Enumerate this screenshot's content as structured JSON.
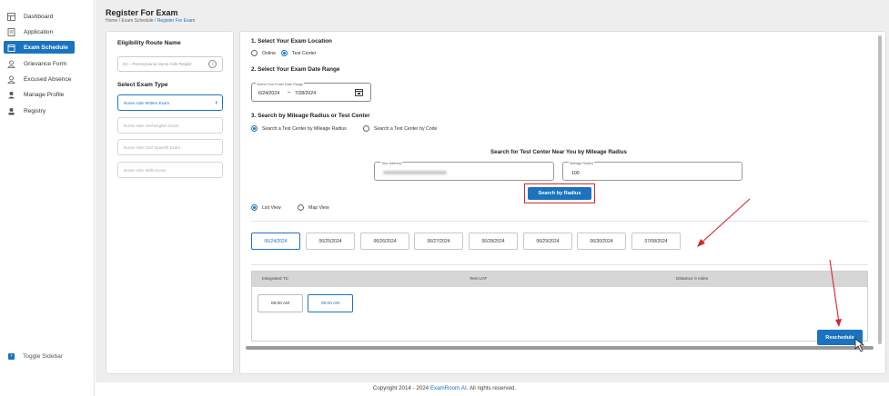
{
  "sidebar": {
    "items": [
      {
        "label": "Dashboard",
        "icon": "grid-icon",
        "active": false
      },
      {
        "label": "Application",
        "icon": "document-icon",
        "active": false
      },
      {
        "label": "Exam Schedule",
        "icon": "calendar-icon",
        "active": true
      },
      {
        "label": "Grievance Form",
        "icon": "person-alert-icon",
        "active": false
      },
      {
        "label": "Excused Absence",
        "icon": "person-alert-icon",
        "active": false
      },
      {
        "label": "Manage Profile",
        "icon": "user-icon",
        "active": false
      },
      {
        "label": "Registry",
        "icon": "user-badge-icon",
        "active": false
      }
    ],
    "toggle_label": "Toggle Sidebar"
  },
  "header": {
    "title": "Register For Exam",
    "breadcrumb": {
      "home": "Home",
      "sep": " / ",
      "middle": "Exam Schedule",
      "current": "Register For Exam"
    }
  },
  "left": {
    "eligibility_title": "Eligibility Route Name",
    "eligibility_value": "E3 – Pennsylvania Nurse Aide Registr",
    "exam_type_title": "Select Exam Type",
    "exam_types": [
      {
        "label": "Nurse Aide Written Exam",
        "selected": true
      },
      {
        "label": "Nurse Aide Oral English Exam",
        "selected": false
      },
      {
        "label": "Nurse Aide Oral Spanish Exam",
        "selected": false
      },
      {
        "label": "Nurse Aide Skills Exam",
        "selected": false
      }
    ]
  },
  "step1": {
    "title": "1. Select Your Exam Location",
    "options": [
      {
        "label": "Online",
        "selected": false
      },
      {
        "label": "Test Center",
        "selected": true
      }
    ]
  },
  "step2": {
    "title": "2. Select Your Exam Date Range",
    "range_label": "Select Your Exam Date Range",
    "start": "6/24/2024",
    "dash": "–",
    "end": "7/28/2024"
  },
  "step3": {
    "title": "3. Search by Mileage Radius or Test Center",
    "options": [
      {
        "label": "Search a Test Center by Mileage Radius",
        "selected": true
      },
      {
        "label": "Search a Test Center by Code",
        "selected": false
      }
    ],
    "search_heading": "Search for Test Center Near You by Mileage Radius",
    "address_label": "Your Address",
    "radius_label": "Mileage Radius",
    "radius_value": "100",
    "search_button": "Search by Radius"
  },
  "view": {
    "options": [
      {
        "label": "List View",
        "selected": true
      },
      {
        "label": "Map View",
        "selected": false
      }
    ]
  },
  "dates": [
    {
      "label": "06/24/2024",
      "selected": true
    },
    {
      "label": "06/25/2024",
      "selected": false
    },
    {
      "label": "06/26/2024",
      "selected": false
    },
    {
      "label": "06/27/2024",
      "selected": false
    },
    {
      "label": "06/28/2024",
      "selected": false
    },
    {
      "label": "06/29/2024",
      "selected": false
    },
    {
      "label": "06/30/2024",
      "selected": false
    },
    {
      "label": "07/08/2024",
      "selected": false
    }
  ],
  "center": {
    "name": "Integrated TC",
    "address": "Test UAT",
    "distance": "Distance 0 miles",
    "slots": [
      {
        "label": "08:00 AM",
        "selected": false
      },
      {
        "label": "08:00 AM",
        "selected": true
      }
    ]
  },
  "reschedule_button": "Reschedule",
  "footer": {
    "prefix": "Copyright 2014 - 2024",
    "brand": "ExamRoom.AI",
    "suffix": ". All rights reserved."
  },
  "colors": {
    "accent": "#1b73c0",
    "annotation": "#d9262c"
  }
}
